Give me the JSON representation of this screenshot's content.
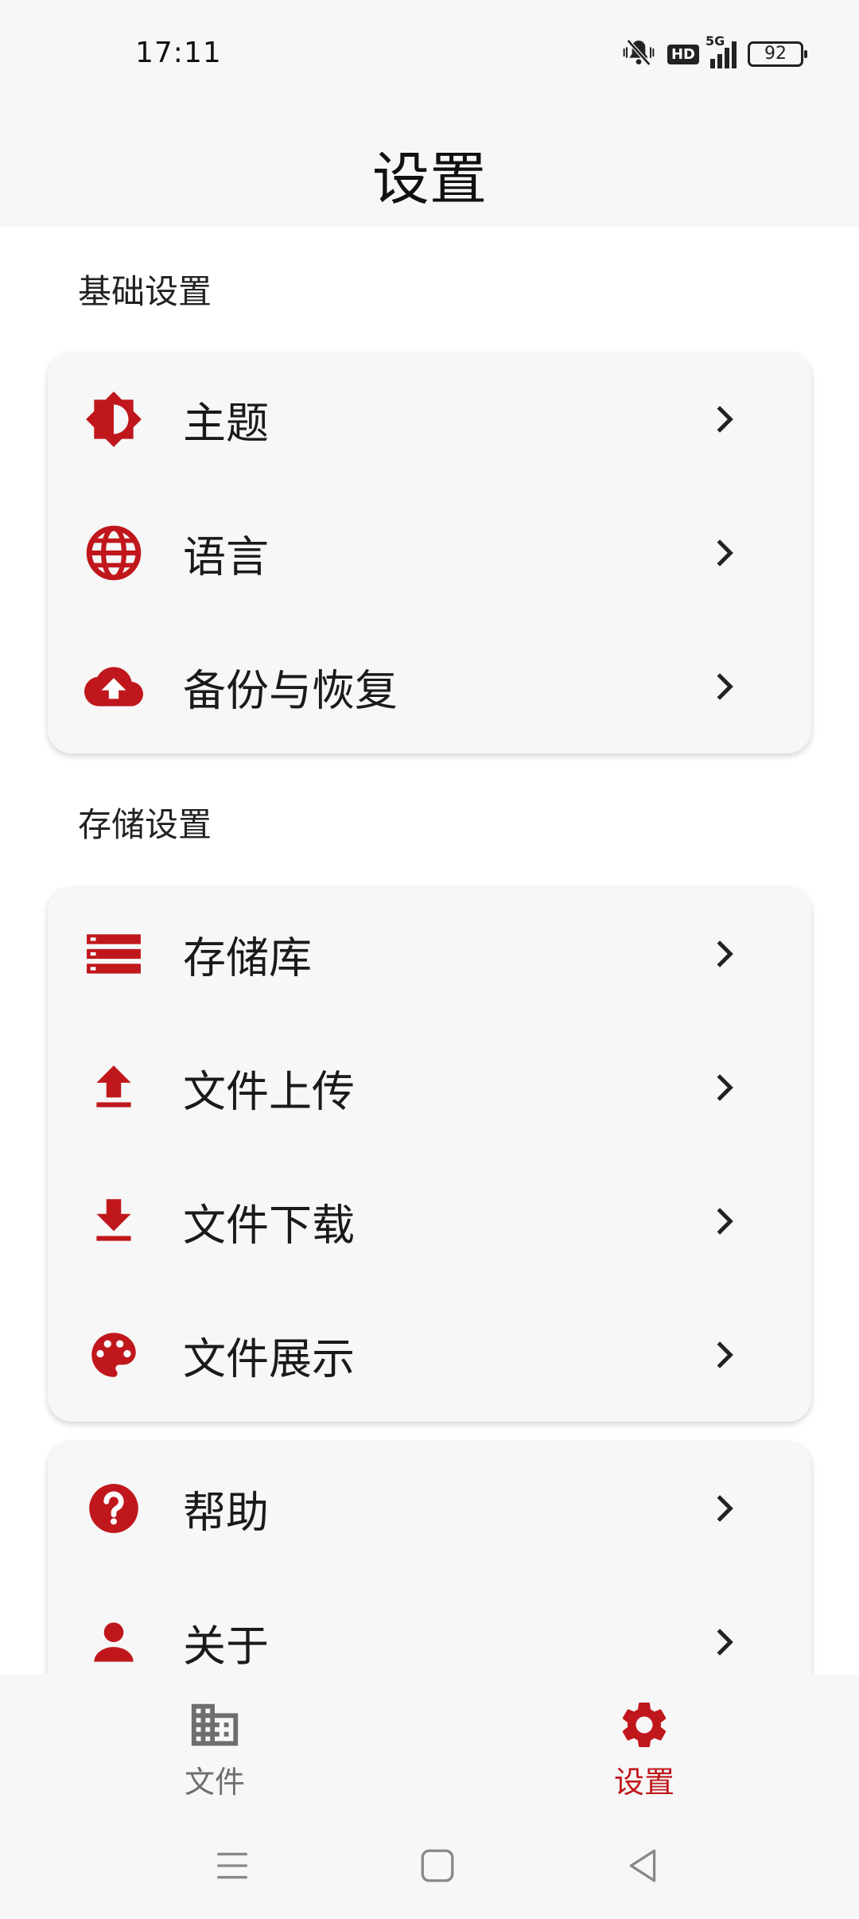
{
  "status_bar": {
    "time": "17:11",
    "hd": "HD",
    "network": "5G",
    "battery": "92"
  },
  "header": {
    "title": "设置"
  },
  "sections": {
    "basic": {
      "label": "基础设置",
      "items": [
        {
          "label": "主题",
          "icon": "brightness-icon"
        },
        {
          "label": "语言",
          "icon": "globe-icon"
        },
        {
          "label": "备份与恢复",
          "icon": "cloud-upload-icon"
        }
      ]
    },
    "storage": {
      "label": "存储设置",
      "items": [
        {
          "label": "存储库",
          "icon": "storage-icon"
        },
        {
          "label": "文件上传",
          "icon": "upload-icon"
        },
        {
          "label": "文件下载",
          "icon": "download-icon"
        },
        {
          "label": "文件展示",
          "icon": "palette-icon"
        }
      ]
    },
    "other": {
      "items": [
        {
          "label": "帮助",
          "icon": "help-icon"
        },
        {
          "label": "关于",
          "icon": "person-icon"
        }
      ]
    }
  },
  "bottom_nav": {
    "items": [
      {
        "label": "文件",
        "icon": "building-icon",
        "active": false
      },
      {
        "label": "设置",
        "icon": "gear-icon",
        "active": true
      }
    ]
  },
  "colors": {
    "accent": "#c0171c",
    "inactive": "#6e6e6e",
    "card": "#f7f7f7"
  }
}
